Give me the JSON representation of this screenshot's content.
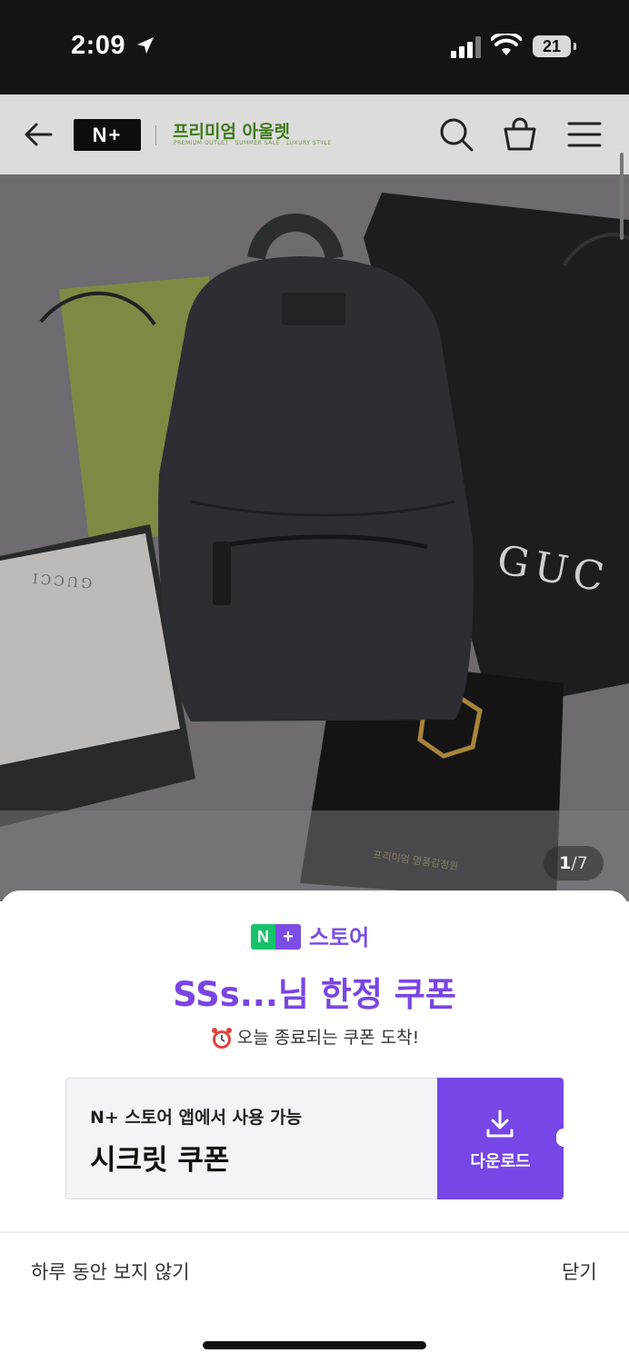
{
  "status_bar": {
    "time": "2:09",
    "battery": "21"
  },
  "header": {
    "logo_text": "N+",
    "brand_name": "프리미엄 아울렛",
    "brand_sub": "PREMIUM OUTLET · SUMMER SALE · LUXURY STYLE"
  },
  "gallery": {
    "current": "1",
    "total": "/7",
    "box_text": "GUCCI",
    "bag_text": "GUC"
  },
  "popup": {
    "badge_left": "N",
    "badge_right": "+",
    "store_label": "스토어",
    "title": "SSs...님 한정 쿠폰",
    "subtitle": "오늘 종료되는 쿠폰 도착!",
    "card_caption": "N+ 스토어 앱에서 사용 가능",
    "card_main": "시크릿 쿠폰",
    "download_label": "다운로드",
    "no_show_today": "하루 동안 보지 않기",
    "close": "닫기"
  },
  "colors": {
    "accent": "#7646e6",
    "green": "#18c26b",
    "brand_green": "#3d7a18"
  }
}
